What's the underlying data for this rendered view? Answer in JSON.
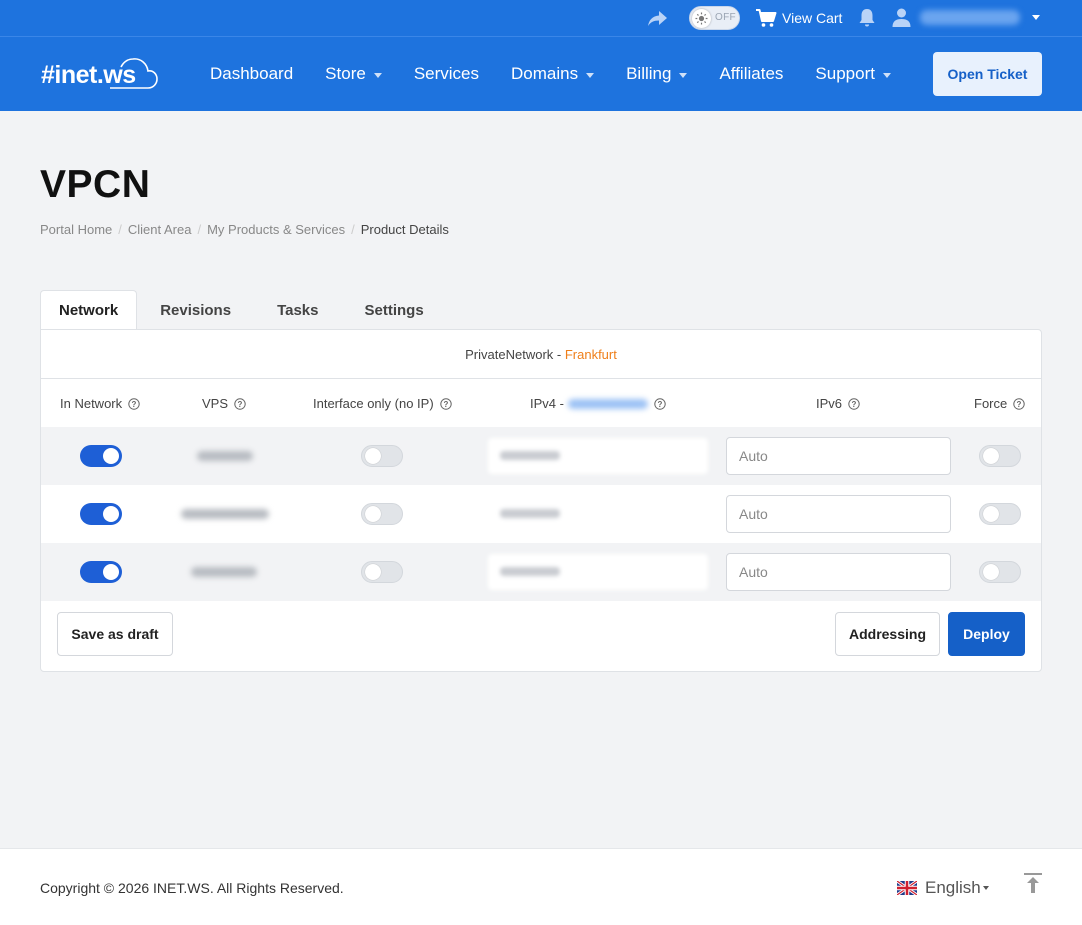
{
  "topbar": {
    "theme_toggle_label": "OFF",
    "view_cart": "View Cart"
  },
  "brand": {
    "logo_text": "#inet.ws"
  },
  "nav": {
    "dashboard": "Dashboard",
    "store": "Store",
    "services": "Services",
    "domains": "Domains",
    "billing": "Billing",
    "affiliates": "Affiliates",
    "support": "Support",
    "open_ticket": "Open Ticket"
  },
  "page": {
    "title": "VPCN",
    "breadcrumb": [
      "Portal Home",
      "Client Area",
      "My Products & Services",
      "Product Details"
    ]
  },
  "tabs": [
    "Network",
    "Revisions",
    "Tasks",
    "Settings"
  ],
  "network": {
    "name": "PrivateNetwork",
    "separator": " - ",
    "location": "Frankfurt"
  },
  "table": {
    "headers": {
      "in_network": "In Network",
      "vps": "VPS",
      "interface_only": "Interface only (no IP)",
      "ipv4": "IPv4 -",
      "ipv6": "IPv6",
      "force": "Force"
    },
    "rows": [
      {
        "in_network": true,
        "interface_only": false,
        "ipv6_placeholder": "Auto",
        "force": false
      },
      {
        "in_network": true,
        "interface_only": false,
        "ipv6_placeholder": "Auto",
        "force": false
      },
      {
        "in_network": true,
        "interface_only": false,
        "ipv6_placeholder": "Auto",
        "force": false
      }
    ]
  },
  "actions": {
    "save_draft": "Save as draft",
    "addressing": "Addressing",
    "deploy": "Deploy"
  },
  "footer": {
    "copyright": "Copyright © 2026 INET.WS. All Rights Reserved.",
    "language": "English"
  },
  "colors": {
    "brand_blue": "#1e73de",
    "deploy_blue": "#1560c8",
    "location_orange": "#ef7f1a",
    "switch_on": "#1e5fd6"
  }
}
